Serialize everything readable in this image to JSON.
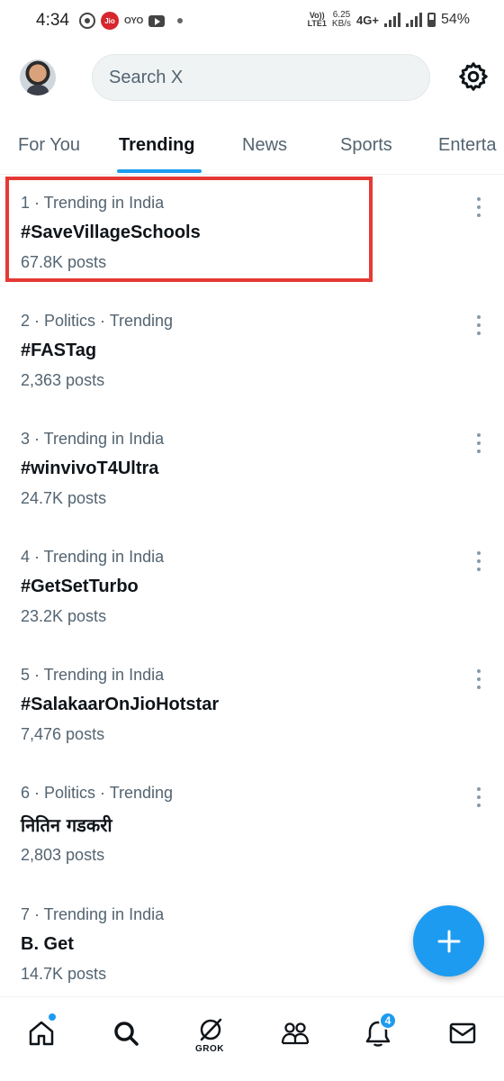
{
  "status_bar": {
    "time": "4:34",
    "jio_label": "Jio",
    "oyo_label": "OYO",
    "volte_label_1": "Vo))",
    "volte_label_2": "LTE1",
    "speed_value": "6.25",
    "speed_unit": "KB/s",
    "network": "4G+",
    "battery": "54%"
  },
  "header": {
    "search_placeholder": "Search X",
    "avatar_icon": "avatar",
    "settings_icon": "gear-icon"
  },
  "tabs": [
    {
      "label": "For You",
      "active": false
    },
    {
      "label": "Trending",
      "active": true
    },
    {
      "label": "News",
      "active": false
    },
    {
      "label": "Sports",
      "active": false
    },
    {
      "label": "Enterta",
      "active": false
    }
  ],
  "trends": [
    {
      "meta": "1 · Trending in India",
      "name": "#SaveVillageSchools",
      "count": "67.8K posts"
    },
    {
      "meta": "2 · Politics · Trending",
      "name": "#FASTag",
      "count": "2,363 posts"
    },
    {
      "meta": "3 · Trending in India",
      "name": "#winvivoT4Ultra",
      "count": "24.7K posts"
    },
    {
      "meta": "4 · Trending in India",
      "name": "#GetSetTurbo",
      "count": "23.2K posts"
    },
    {
      "meta": "5 · Trending in India",
      "name": "#SalakaarOnJioHotstar",
      "count": "7,476 posts"
    },
    {
      "meta": "6 · Politics · Trending",
      "name": "नितिन गडकरी",
      "count": "2,803 posts"
    },
    {
      "meta": "7 · Trending in India",
      "name": "B. Get",
      "count": "14.7K posts"
    }
  ],
  "bottom_nav": {
    "grok_label": "GROK",
    "notifications_badge": "4",
    "items": [
      "home-icon",
      "search-icon",
      "grok-icon",
      "communities-icon",
      "notifications-icon",
      "messages-icon"
    ]
  },
  "colors": {
    "accent": "#1d9bf0",
    "highlight": "#e53935",
    "secondary_text": "#536471"
  }
}
